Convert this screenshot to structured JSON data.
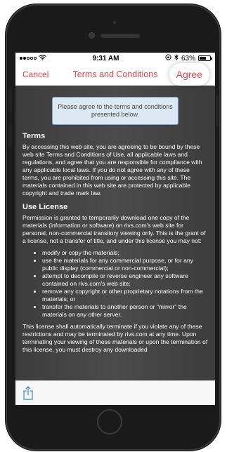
{
  "status_bar": {
    "time": "9:31 AM",
    "battery": "63%",
    "battery_level": 0.63,
    "signal_bars_filled": 2
  },
  "nav": {
    "cancel_label": "Cancel",
    "title": "Terms and Conditions",
    "agree_label": "Agree"
  },
  "notice": "Please agree to the terms and conditions presented below.",
  "terms": {
    "heading": "Terms",
    "body": "By accessing this web site, you are agreeing to be bound by these web site Terms and Conditions of Use, all applicable laws and regulations, and agree that you are responsible for compliance with any applicable local laws. If you do not agree with any of these terms, you are prohibited from using or accessing this site. The materials contained in this web site are protected by applicable copyright and trade mark law."
  },
  "use_license": {
    "heading": "Use License",
    "intro": "Permission is granted to temporarily download one copy of the materials (information or software) on rivs.com's web site for personal, non-commercial transitory viewing only. This is the grant of a license, not a transfer of title, and under this license you may not:",
    "items": [
      "modify or copy the materials;",
      "use the materials for any commercial purpose, or for any public display (commercial or non-commercial);",
      "attempt to decompile or reverse engineer any software contained on rivs.com's web site;",
      "remove any copyright or other proprietary notations from the materials; or",
      "transfer the materials to another person or \"mirror\" the materials on any other server."
    ],
    "closing": "This license shall automatically terminate if you violate any of these restrictions and may be terminated by rivs.com at any time. Upon terminating your viewing of these materials or upon the termination of this license, you must destroy any downloaded"
  },
  "colors": {
    "accent": "#e8444a",
    "content_bg": "#474747",
    "notice_bg": "#dde8f5",
    "share_icon": "#3b8ee8"
  },
  "icons": {
    "share": "share-icon",
    "wifi": "wifi-icon",
    "bluetooth": "bluetooth-icon",
    "orientation_lock": "orientation-lock-icon"
  }
}
